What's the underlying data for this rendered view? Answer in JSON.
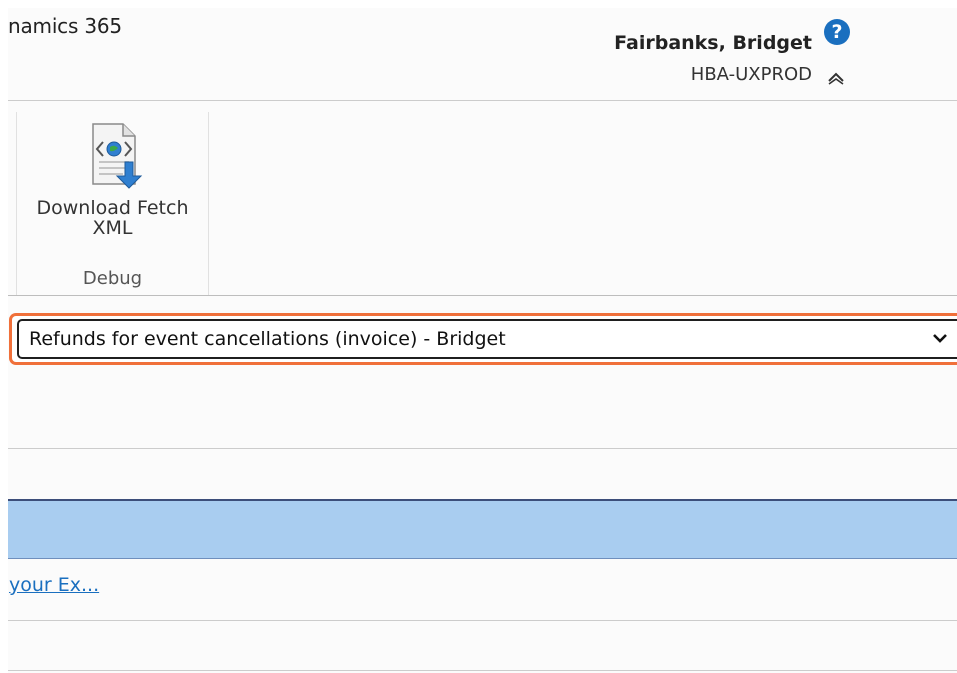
{
  "header": {
    "app_name": "namics 365",
    "user_name": "Fairbanks, Bridget",
    "org_name": "HBA-UXPROD",
    "help_glyph": "?"
  },
  "ribbon": {
    "button_label_line1": "Download Fetch",
    "button_label_line2": "XML",
    "group_title": "Debug",
    "icon": "xml-document-download-icon"
  },
  "view_selector": {
    "selected_value": "Refunds for event cancellations (invoice) - Bridget"
  },
  "link": {
    "text": "your Ex..."
  },
  "colors": {
    "highlight": "#f0703a",
    "band": "#a9cdf0",
    "link": "#1a6fbf",
    "help": "#1a6fbf"
  }
}
